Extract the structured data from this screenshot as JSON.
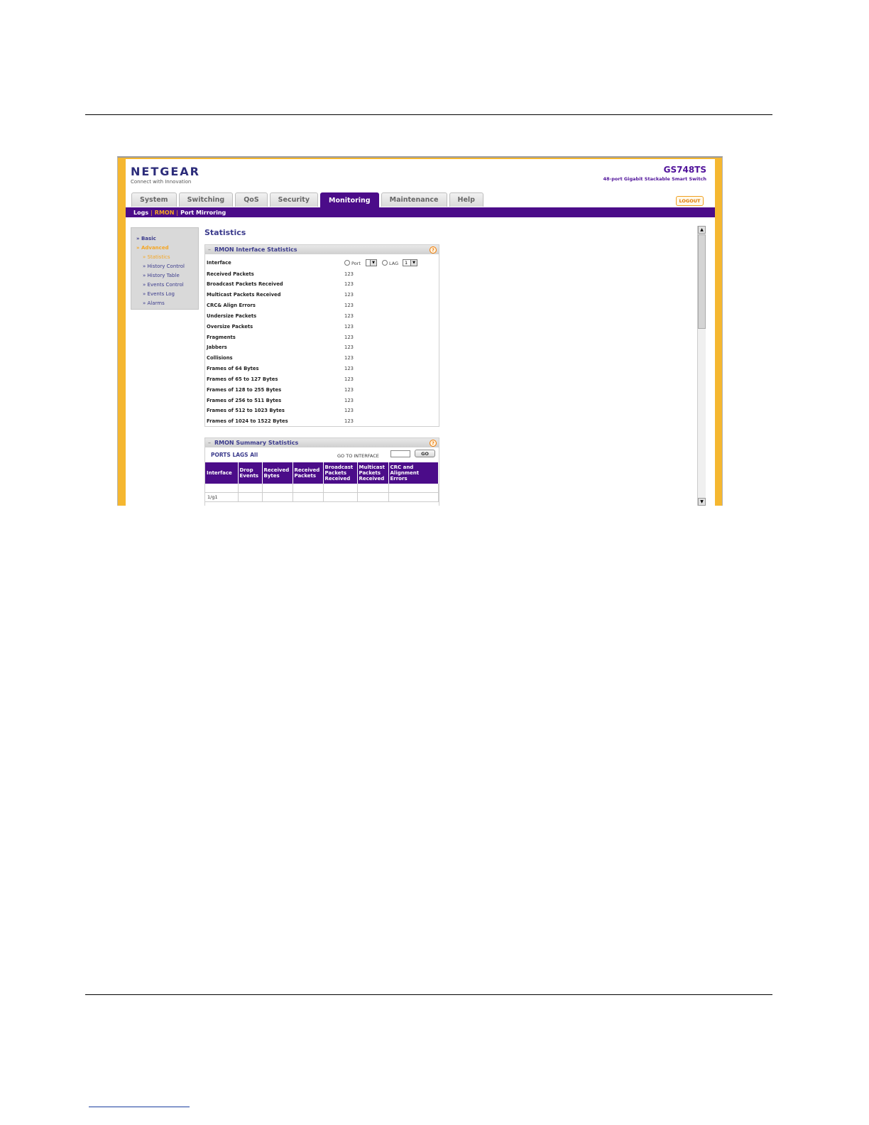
{
  "brand": {
    "name": "NETGEAR",
    "tagline": "Connect with Innovation"
  },
  "model": {
    "name": "GS748TS",
    "description": "48-port Gigabit Stackable Smart Switch"
  },
  "tabs": [
    {
      "label": "System",
      "active": false
    },
    {
      "label": "Switching",
      "active": false
    },
    {
      "label": "QoS",
      "active": false
    },
    {
      "label": "Security",
      "active": false
    },
    {
      "label": "Monitoring",
      "active": true
    },
    {
      "label": "Maintenance",
      "active": false
    },
    {
      "label": "Help",
      "active": false
    }
  ],
  "logout_label": "LOGOUT",
  "subnav": [
    {
      "label": "Logs",
      "active": false
    },
    {
      "label": "RMON",
      "active": true
    },
    {
      "label": "Port Mirroring",
      "active": false
    }
  ],
  "sidebar": {
    "basic": "Basic",
    "advanced": "Advanced",
    "items": [
      "Statistics",
      "History Control",
      "History Table",
      "Events Control",
      "Events Log",
      "Alarms"
    ]
  },
  "page_title": "Statistics",
  "interface_panel": {
    "title": "RMON Interface Statistics",
    "interface_label": "Interface",
    "port_label": "Port",
    "lag_label": "LAG",
    "lag_value": "1",
    "rows": [
      {
        "label": "Received Packets",
        "value": "123"
      },
      {
        "label": "Broadcast Packets Received",
        "value": "123"
      },
      {
        "label": "Multicast Packets Received",
        "value": "123"
      },
      {
        "label": "CRC& Align Errors",
        "value": "123"
      },
      {
        "label": "Undersize Packets",
        "value": "123"
      },
      {
        "label": "Oversize Packets",
        "value": "123"
      },
      {
        "label": "Fragments",
        "value": "123"
      },
      {
        "label": "Jabbers",
        "value": "123"
      },
      {
        "label": "Collisions",
        "value": "123"
      },
      {
        "label": "Frames of 64 Bytes",
        "value": "123"
      },
      {
        "label": "Frames of 65 to 127 Bytes",
        "value": "123"
      },
      {
        "label": "Frames of 128 to 255 Bytes",
        "value": "123"
      },
      {
        "label": "Frames of 256 to 511 Bytes",
        "value": "123"
      },
      {
        "label": "Frames of 512 to 1023 Bytes",
        "value": "123"
      },
      {
        "label": "Frames of 1024 to 1522 Bytes",
        "value": "123"
      }
    ]
  },
  "summary_panel": {
    "title": "RMON Summary Statistics",
    "links": "PORTS LAGS All",
    "goto_label": "GO TO INTERFACE",
    "go_button": "GO",
    "columns": [
      "Interface",
      "Drop Events",
      "Received Bytes",
      "Received Packets",
      "Broadcast Packets Received",
      "Multicast Packets Received",
      "CRC and Alignment Errors"
    ],
    "rows": [
      [
        "",
        "",
        "",
        "",
        "",
        "",
        ""
      ],
      [
        "1/g1",
        "",
        "",
        "",
        "",
        "",
        ""
      ]
    ]
  },
  "colors": {
    "accent_purple": "#4b0c89",
    "frame_orange": "#f5b730",
    "link_blue": "#3b3b8c"
  }
}
